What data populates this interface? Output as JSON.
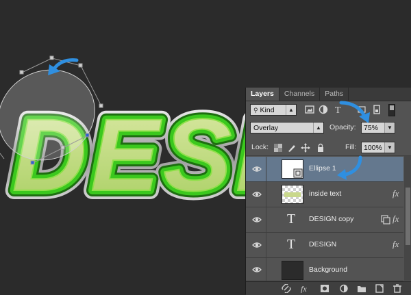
{
  "artwork": {
    "text": "DESI"
  },
  "panel": {
    "tabs": [
      "Layers",
      "Channels",
      "Paths"
    ],
    "filter_kind": "Kind",
    "blend_mode": "Overlay",
    "opacity_label": "Opacity:",
    "opacity_value": "75%",
    "lock_label": "Lock:",
    "fill_label": "Fill:",
    "fill_value": "100%",
    "layers": [
      {
        "name": "Ellipse 1",
        "type": "shape",
        "selected": true,
        "fx": false
      },
      {
        "name": "inside text",
        "type": "image",
        "selected": false,
        "fx": true
      },
      {
        "name": "DESIGN copy",
        "type": "text",
        "selected": false,
        "fx": false,
        "smart": true
      },
      {
        "name": "DESIGN",
        "type": "text",
        "selected": false,
        "fx": true
      },
      {
        "name": "Background",
        "type": "background",
        "selected": false,
        "fx": false
      }
    ],
    "fx_symbol": "fx",
    "text_glyph": "T",
    "bottom_icons": [
      "link-icon",
      "fx-icon",
      "mask-icon",
      "adjustment-icon",
      "folder-icon",
      "new-layer-icon",
      "trash-icon"
    ]
  },
  "colors": {
    "annotation_arrow": "#2f8fe0",
    "text_fill": "#c9e08a",
    "text_stroke": "#3bc81e"
  }
}
